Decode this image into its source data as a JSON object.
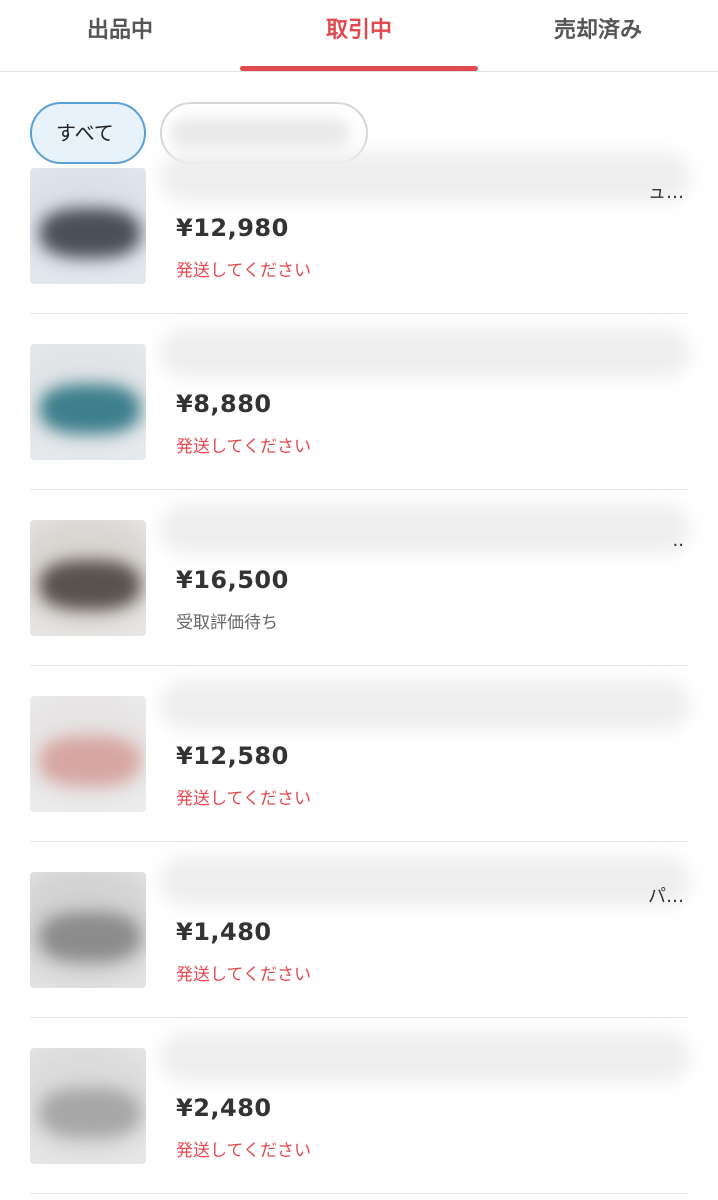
{
  "tabs": {
    "items": [
      {
        "label": "出品中"
      },
      {
        "label": "取引中"
      },
      {
        "label": "売却済み"
      }
    ],
    "active_color": "#e04a4f"
  },
  "filters": {
    "chip_all": "すべて",
    "chip_2": ""
  },
  "items": [
    {
      "title_tail": "ュ…",
      "price": "¥12,980",
      "status": "発送してください"
    },
    {
      "title_tail": "",
      "price": "¥8,880",
      "status": "発送してください"
    },
    {
      "title_tail": "..",
      "price": "¥16,500",
      "status": "受取評価待ち"
    },
    {
      "title_tail": "",
      "price": "¥12,580",
      "status": "発送してください"
    },
    {
      "title_tail": "パ…",
      "price": "¥1,480",
      "status": "発送してください"
    },
    {
      "title_tail": "",
      "price": "¥2,480",
      "status": "発送してください"
    }
  ],
  "colors": {
    "accent": "#e04a4f",
    "chip_active_border": "#58a0d8",
    "status_action": "#e04a4f",
    "status_waiting": "#666666"
  }
}
